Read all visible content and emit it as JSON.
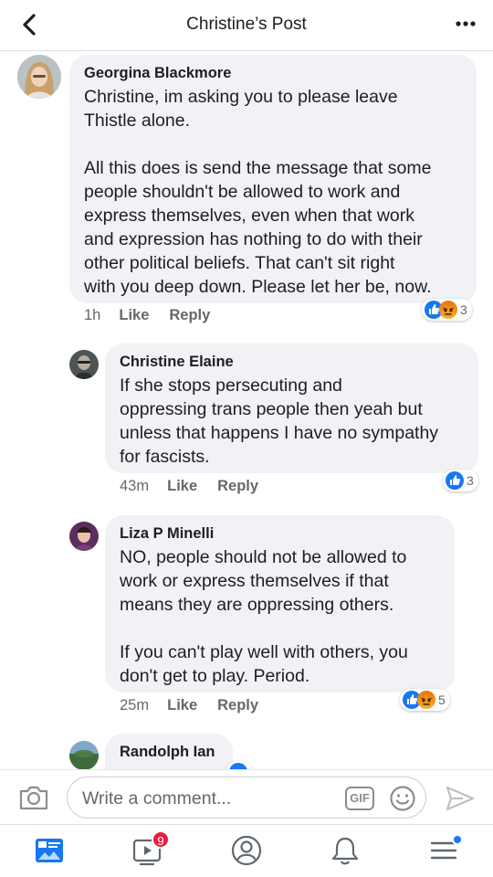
{
  "header": {
    "title": "Christine’s Post",
    "back_icon": "chevron-left-icon",
    "more_icon": "more-horizontal-icon"
  },
  "comments": [
    {
      "author": "Georgina Blackmore",
      "text": "Christine, im asking you to please leave\nThistle alone.\n\nAll this does is send the message that some\npeople shouldn't be allowed to work and\nexpress themselves, even when that work\nand expression has nothing to do with their\nother political beliefs. That can't sit right\nwith you deep down. Please let her be, now.",
      "time": "1h",
      "like_label": "Like",
      "reply_label": "Reply",
      "reactions": [
        "like",
        "angry"
      ],
      "reaction_count": "3"
    },
    {
      "author": "Christine Elaine",
      "text": "If she stops persecuting and\noppressing trans people then yeah but\nunless that happens I have no sympathy\nfor fascists.",
      "time": "43m",
      "like_label": "Like",
      "reply_label": "Reply",
      "reactions": [
        "like"
      ],
      "reaction_count": "3"
    },
    {
      "author": "Liza P Minelli",
      "text": "NO, people should not be allowed to\nwork or express themselves if that\nmeans they are oppressing others.\n\nIf you can't play well with others,  you\ndon't get to play.  Period.",
      "time": "25m",
      "like_label": "Like",
      "reply_label": "Reply",
      "reactions": [
        "like",
        "angry"
      ],
      "reaction_count": "5"
    },
    {
      "author": "Randolph Ian",
      "text": "",
      "reactions": [
        "like"
      ],
      "reaction_count": ""
    }
  ],
  "composer": {
    "placeholder": "Write a comment...",
    "gif_label": "GIF",
    "camera_icon": "camera-icon",
    "emoji_icon": "emoji-icon",
    "send_icon": "send-icon"
  },
  "nav": {
    "items": [
      "news-feed-icon",
      "watch-video-icon",
      "profile-icon",
      "notifications-bell-icon",
      "menu-icon"
    ],
    "watch_badge": "9"
  },
  "colors": {
    "accent": "#1877f2",
    "bubble": "#f0f2f5",
    "badge": "#e41e3f"
  }
}
